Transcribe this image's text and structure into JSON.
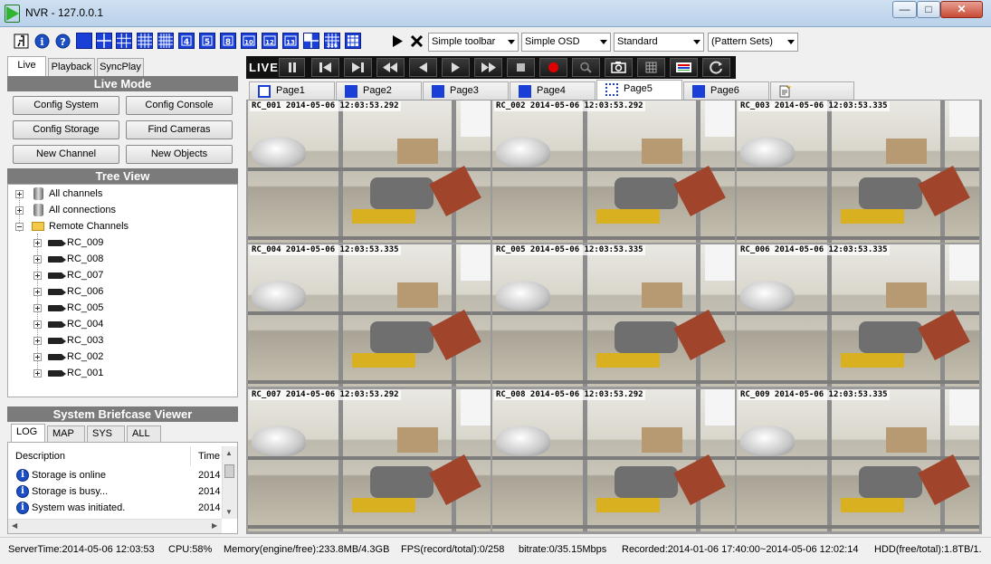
{
  "window": {
    "title": "NVR - 127.0.0.1"
  },
  "toolbar": {
    "layout_icons": [
      "1",
      "4",
      "9",
      "16",
      "16w",
      "25",
      "4",
      "5",
      "8",
      "10",
      "12",
      "13",
      "4b",
      "36"
    ],
    "selects": {
      "toolbar_mode": "Simple toolbar",
      "osd_mode": "Simple OSD",
      "quality": "Standard",
      "pattern": "(Pattern Sets)"
    }
  },
  "left_tabs": [
    "Live",
    "Playback",
    "SyncPlay"
  ],
  "live_mode": {
    "title": "Live Mode",
    "buttons": [
      "Config System",
      "Config Console",
      "Config Storage",
      "Find Cameras",
      "New Channel",
      "New Objects"
    ]
  },
  "tree_view": {
    "title": "Tree View",
    "roots": [
      "All channels",
      "All connections",
      "Remote Channels"
    ],
    "channels": [
      "RC_009",
      "RC_008",
      "RC_007",
      "RC_006",
      "RC_005",
      "RC_004",
      "RC_003",
      "RC_002",
      "RC_001"
    ]
  },
  "briefcase": {
    "title": "System Briefcase Viewer",
    "tabs": [
      "LOG",
      "MAP",
      "SYS",
      "ALL"
    ],
    "columns": [
      "Description",
      "Time"
    ],
    "rows": [
      {
        "description": "Storage is online",
        "time": "2014"
      },
      {
        "description": "Storage is busy...",
        "time": "2014"
      },
      {
        "description": "System was initiated.",
        "time": "2014"
      }
    ]
  },
  "playback_bar": {
    "live_label": "LIVE"
  },
  "pages": [
    "Page1",
    "Page2",
    "Page3",
    "Page4",
    "Page5",
    "Page6"
  ],
  "active_page": "Page5",
  "cameras": [
    {
      "osd": "RC_001 2014-05-06 12:03:53.292"
    },
    {
      "osd": "RC_002 2014-05-06 12:03:53.292"
    },
    {
      "osd": "RC_003 2014-05-06 12:03:53.335"
    },
    {
      "osd": "RC_004 2014-05-06 12:03:53.335"
    },
    {
      "osd": "RC_005 2014-05-06 12:03:53.335"
    },
    {
      "osd": "RC_006 2014-05-06 12:03:53.335"
    },
    {
      "osd": "RC_007 2014-05-06 12:03:53.292"
    },
    {
      "osd": "RC_008 2014-05-06 12:03:53.292"
    },
    {
      "osd": "RC_009 2014-05-06 12:03:53.335"
    }
  ],
  "status": {
    "server_time": "ServerTime:2014-05-06 12:03:53",
    "cpu": "CPU:58%",
    "memory": "Memory(engine/free):233.8MB/4.3GB",
    "fps": "FPS(record/total):0/258",
    "bitrate": "bitrate:0/35.15Mbps",
    "recorded": "Recorded:2014-01-06 17:40:00~2014-05-06 12:02:14",
    "hdd": "HDD(free/total):1.8TB/1."
  },
  "colors": {
    "accent": "#1a3fd6",
    "record": "#e00000",
    "section": "#7b7b7b"
  }
}
